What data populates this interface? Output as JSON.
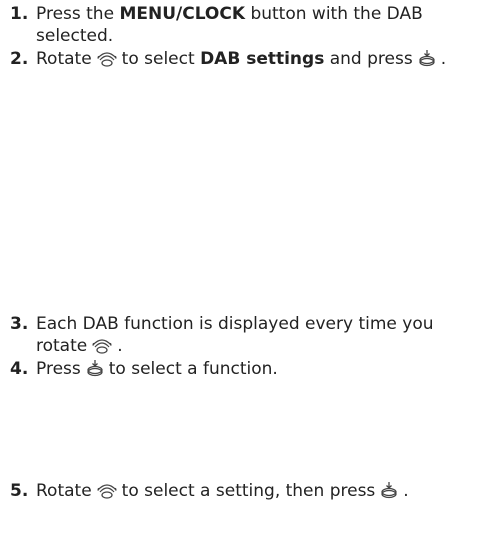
{
  "steps": [
    {
      "number": "1.",
      "parts": [
        "Press the",
        "MENU/CLOCK",
        "button with the DAB selected."
      ]
    },
    {
      "number": "2.",
      "parts": [
        "Rotate",
        "to select",
        "DAB settings",
        "and press",
        "."
      ]
    },
    {
      "number": "3.",
      "parts": [
        "Each DAB function is displayed every time you rotate",
        "."
      ]
    },
    {
      "number": "4.",
      "parts": [
        "Press",
        "to select a function."
      ]
    },
    {
      "number": "5.",
      "parts": [
        "Rotate",
        "to select a setting, then press",
        "."
      ]
    }
  ],
  "icons": {
    "rotate": "rotary-knob-icon",
    "press": "press-knob-icon"
  }
}
